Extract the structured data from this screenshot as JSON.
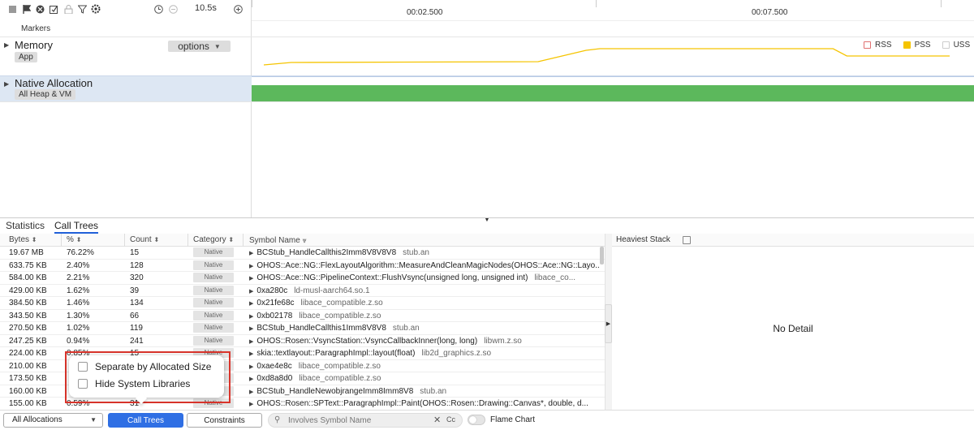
{
  "toolbar": {
    "icons": [
      "stop-icon",
      "flag-icon",
      "record-icon",
      "export-icon",
      "lock-icon",
      "filter-icon",
      "settings-icon",
      "clock-icon",
      "minus-circle-icon",
      "plus-circle-icon"
    ],
    "duration": "10.5s"
  },
  "timeline": {
    "ticks": [
      "00:02.500",
      "00:07.500"
    ]
  },
  "lanes": {
    "markers": "Markers",
    "memory": {
      "title": "Memory",
      "chip": "App",
      "options_label": "options"
    },
    "native": {
      "title": "Native Allocation",
      "chip": "All Heap & VM"
    }
  },
  "legend": [
    {
      "label": "RSS",
      "color": "#ffffff",
      "border": "#e07070"
    },
    {
      "label": "PSS",
      "color": "#f5c400",
      "border": "#f5c400"
    },
    {
      "label": "USS",
      "color": "#ffffff",
      "border": "#cccccc"
    }
  ],
  "colors": {
    "pss_line": "#f5c400",
    "native_bar": "#5cb85c",
    "accent": "#2f6fe4"
  },
  "pss_series": {
    "points": [
      [
        0,
        34
      ],
      [
        0.04,
        31
      ],
      [
        0.4,
        30
      ],
      [
        0.42,
        26
      ],
      [
        0.47,
        16
      ],
      [
        0.49,
        14
      ],
      [
        0.83,
        14
      ],
      [
        0.85,
        23
      ],
      [
        0.93,
        23
      ],
      [
        1.0,
        23
      ]
    ]
  },
  "tabs": [
    {
      "label": "Statistics",
      "active": false
    },
    {
      "label": "Call Trees",
      "active": true
    }
  ],
  "table": {
    "headers": {
      "bytes": "Bytes",
      "pct": "%",
      "count": "Count",
      "category": "Category",
      "symbol": "Symbol Name"
    },
    "rows": [
      {
        "bytes": "19.67 MB",
        "pct": "76.22%",
        "count": "15",
        "category": "Native",
        "symbol": "BCStub_HandleCallthis2Imm8V8V8V8",
        "lib": "stub.an"
      },
      {
        "bytes": "633.75 KB",
        "pct": "2.40%",
        "count": "128",
        "category": "Native",
        "symbol": "OHOS::Ace::NG::FlexLayoutAlgorithm::MeasureAndCleanMagicNodes(OHOS::Ace::NG::Layo...",
        "lib": ""
      },
      {
        "bytes": "584.00 KB",
        "pct": "2.21%",
        "count": "320",
        "category": "Native",
        "symbol": "OHOS::Ace::NG::PipelineContext::FlushVsync(unsigned long, unsigned int)",
        "lib": "libace_co..."
      },
      {
        "bytes": "429.00 KB",
        "pct": "1.62%",
        "count": "39",
        "category": "Native",
        "symbol": "0xa280c",
        "lib": "ld-musl-aarch64.so.1"
      },
      {
        "bytes": "384.50 KB",
        "pct": "1.46%",
        "count": "134",
        "category": "Native",
        "symbol": "0x21fe68c",
        "lib": "libace_compatible.z.so"
      },
      {
        "bytes": "343.50 KB",
        "pct": "1.30%",
        "count": "66",
        "category": "Native",
        "symbol": "0xb02178",
        "lib": "libace_compatible.z.so"
      },
      {
        "bytes": "270.50 KB",
        "pct": "1.02%",
        "count": "119",
        "category": "Native",
        "symbol": "BCStub_HandleCallthis1Imm8V8V8",
        "lib": "stub.an"
      },
      {
        "bytes": "247.25 KB",
        "pct": "0.94%",
        "count": "241",
        "category": "Native",
        "symbol": "OHOS::Rosen::VsyncStation::VsyncCallbackInner(long, long)",
        "lib": "libwm.z.so"
      },
      {
        "bytes": "224.00 KB",
        "pct": "0.85%",
        "count": "15",
        "category": "Native",
        "symbol": "skia::textlayout::ParagraphImpl::layout(float)",
        "lib": "lib2d_graphics.z.so"
      },
      {
        "bytes": "210.00 KB",
        "pct": "",
        "count": "",
        "category": "Native",
        "symbol": "0xae4e8c",
        "lib": "libace_compatible.z.so"
      },
      {
        "bytes": "173.50 KB",
        "pct": "",
        "count": "",
        "category": "Native",
        "symbol": "0xd8a8d0",
        "lib": "libace_compatible.z.so"
      },
      {
        "bytes": "160.00 KB",
        "pct": "",
        "count": "",
        "category": "Native",
        "symbol": "BCStub_HandleNewobjrangeImm8Imm8V8",
        "lib": "stub.an"
      },
      {
        "bytes": "155.00 KB",
        "pct": "0.59%",
        "count": "31",
        "category": "Native",
        "symbol": "OHOS::Rosen::SPText::ParagraphImpl::Paint(OHOS::Rosen::Drawing::Canvas*, double, d...",
        "lib": ""
      }
    ]
  },
  "heaviest": {
    "title": "Heaviest Stack",
    "empty": "No Detail"
  },
  "popup": {
    "options": [
      "Separate by Allocated Size",
      "Hide System Libraries"
    ]
  },
  "footer": {
    "alloc_select": "All Allocations",
    "calltrees": "Call Trees",
    "constraints": "Constraints",
    "search_placeholder": "Involves Symbol Name",
    "case_label": "Cc",
    "flame_chart": "Flame Chart"
  }
}
